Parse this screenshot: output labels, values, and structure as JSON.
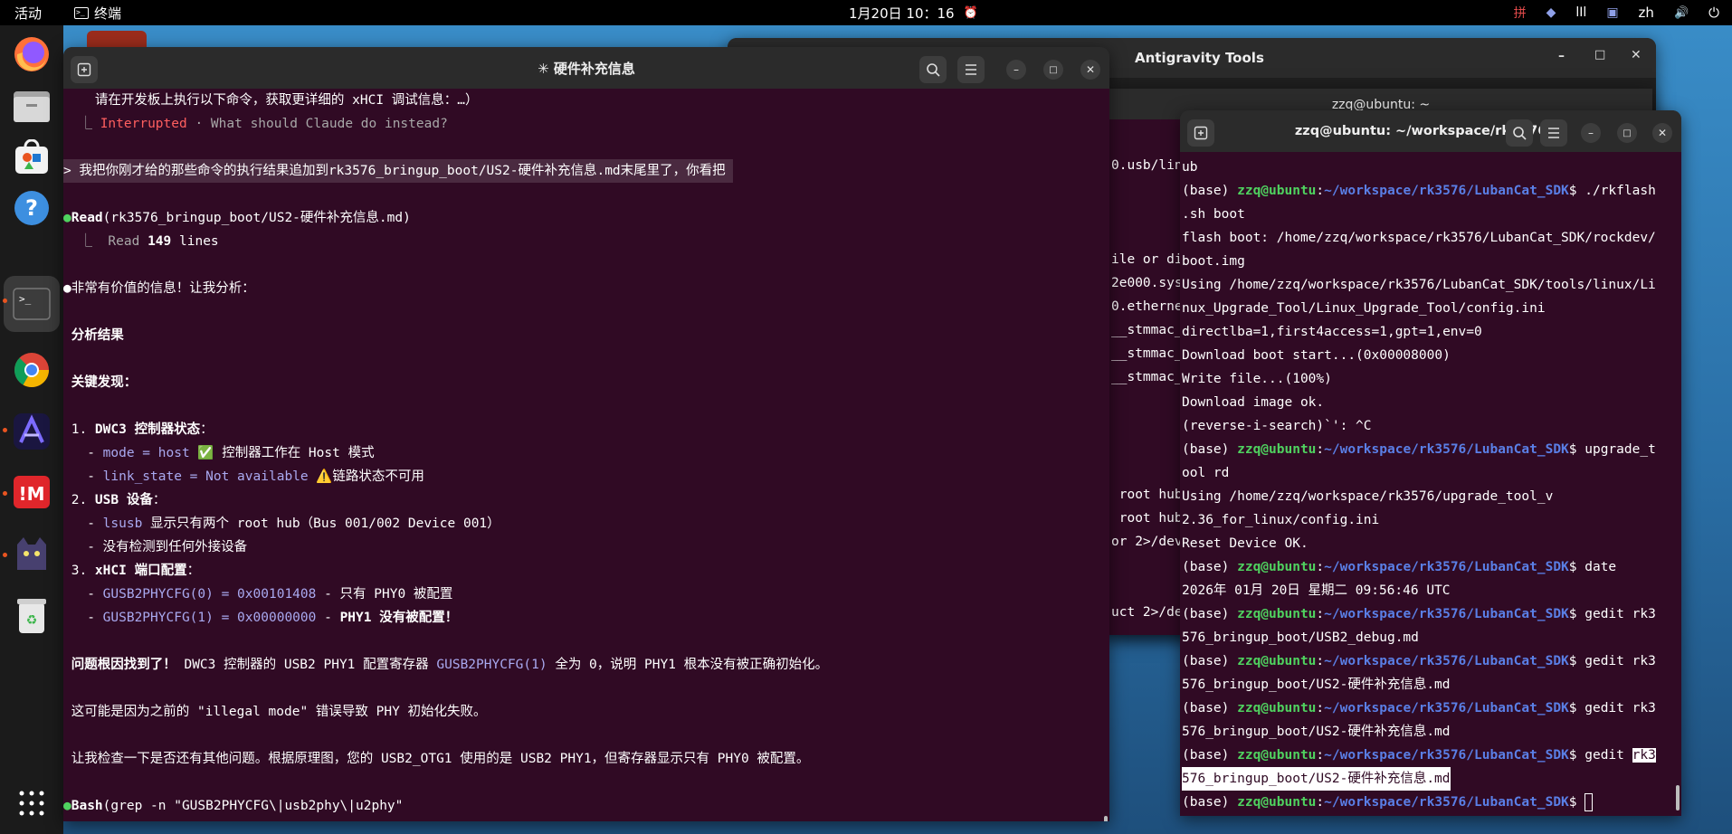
{
  "topbar": {
    "activities": "活动",
    "app_name": "终端",
    "clock": "1月20日 10：16",
    "alarm_icon": "⏰",
    "input_method": "zh",
    "tray_icons": [
      "input-method-red-icon",
      "shield-icon",
      "bars-icon",
      "cat-icon"
    ],
    "tray_glyphs": [
      "拼",
      "◆",
      "lIl",
      "▣"
    ],
    "volume_glyph": "🔊",
    "power_glyph": "⏻"
  },
  "dock": {
    "items": [
      "firefox-icon",
      "files-icon",
      "software-center-icon",
      "help-icon",
      "terminal-icon",
      "chrome-icon",
      "antigravity-icon",
      "app-red-icon",
      "cat-app-icon",
      "trash-icon"
    ],
    "grid_glyph": "⋮⋮⋮"
  },
  "win_anti": {
    "title": "Antigravity Tools",
    "lines": [
      "0.usb/lin",
      "",
      "ile or di",
      "2e000.sys",
      "0.etherne",
      "__stmmac_",
      "__stmmac_",
      "__stmmac_",
      "",
      "",
      "",
      "",
      "",
      " root hub",
      " root hub",
      "or 2>/dev",
      "",
      "",
      "uct 2>/de"
    ]
  },
  "win_mid": {
    "title": "zzq@ubuntu: ~"
  },
  "win_main": {
    "title": "✳ 硬件补充信息",
    "lines": {
      "l0": "    请在开发板上执行以下命令，获取更详细的 xHCI 调试信息：…）",
      "l1a": "  ⎿ ",
      "l1b": "Interrupted",
      "l1c": " · What should Claude do instead?",
      "l2": "> 我把你刚才给的那些命令的执行结果追加到rk3576_bringup_boot/US2-硬件补充信息.md末尾里了，你看把 ",
      "l3_dot": "●",
      "l3_bold": "Read",
      "l3_rest": "(rk3576_bringup_boot/US2-硬件补充信息.md)",
      "l4a": "  ⎿  Read ",
      "l4b": "149",
      "l4c": " lines",
      "l5_dot": "●",
      "l5": "非常有价值的信息！让我分析：",
      "l6": " 分析结果",
      "l7": " 关键发现：",
      "l8a": " 1. ",
      "l8b": "DWC3 控制器状态",
      "l8c": "：",
      "l9a": "   - ",
      "l9b": "mode = host",
      "l9c": " ✅ 控制器工作在 Host 模式",
      "l10a": "   - ",
      "l10b": "link_state = Not available",
      "l10c": " ⚠️链路状态不可用",
      "l11a": " 2. ",
      "l11b": "USB 设备",
      "l11c": "：",
      "l12a": "   - ",
      "l12b": "lsusb",
      "l12c": " 显示只有两个 root hub（Bus 001/002 Device 001）",
      "l13": "   - 没有检测到任何外接设备",
      "l14a": " 3. ",
      "l14b": "xHCI 端口配置",
      "l14c": "：",
      "l15a": "   - ",
      "l15b": "GUSB2PHYCFG(0) = 0x00101408",
      "l15c": " - 只有 PHY0 被配置",
      "l16a": "   - ",
      "l16b": "GUSB2PHYCFG(1) = 0x00000000",
      "l16c": " - ",
      "l16d": "PHY1 没有被配置！",
      "l17a": " 问题根因找到了！",
      "l17b": " DWC3 控制器的 USB2 PHY1 配置寄存器 ",
      "l17c": "GUSB2PHYCFG(1)",
      "l17d": " 全为 0，说明 PHY1 根本没有被正确初始化。",
      "l18": " 这可能是因为之前的 \"illegal mode\" 错误导致 PHY 初始化失败。",
      "l19": " 让我检查一下是否还有其他问题。根据原理图，您的 USB2_OTG1 使用的是 USB2 PHY1，但寄存器显示只有 PHY0 被配置。",
      "l20_dot": "●",
      "l20_bold": "Bash",
      "l20_rest": "(grep -n \"GUSB2PHYCFG\\|usb2phy\\|u2phy\""
    }
  },
  "win_right": {
    "title": "zzq@ubuntu: ~/workspace/rk3576/...",
    "prompt_user": "zzq@ubuntu",
    "prompt_path": "~/workspace/rk3576/LubanCat_SDK",
    "base": "(base) ",
    "lines": [
      "ub",
      "$ ./rkflash",
      ".sh boot",
      "flash boot: /home/zzq/workspace/rk3576/LubanCat_SDK/rockdev/",
      "boot.img",
      "Using /home/zzq/workspace/rk3576/LubanCat_SDK/tools/linux/Li",
      "nux_Upgrade_Tool/Linux_Upgrade_Tool/config.ini",
      "directlba=1,first4access=1,gpt=1,env=0",
      "Download boot start...(0x00008000)",
      "Write file...(100%)",
      "Download image ok.",
      "(reverse-i-search)`': ^C",
      "$ upgrade_t",
      "ool rd",
      "Using /home/zzq/workspace/rk3576/upgrade_tool_v",
      "2.36_for_linux/config.ini",
      "Reset Device OK.",
      "$ date",
      "2026年 01月 20日 星期二 09:56:46 UTC",
      "$ gedit rk3",
      "576_bringup_boot/USB2_debug.md",
      "$ gedit rk3",
      "576_bringup_boot/US2-硬件补充信息.md",
      "$ gedit rk3",
      "576_bringup_boot/US2-硬件补充信息.md",
      "$ gedit ",
      "rk3",
      "576_bringup_boot/US2-硬件补充信息.md",
      "$ "
    ]
  }
}
